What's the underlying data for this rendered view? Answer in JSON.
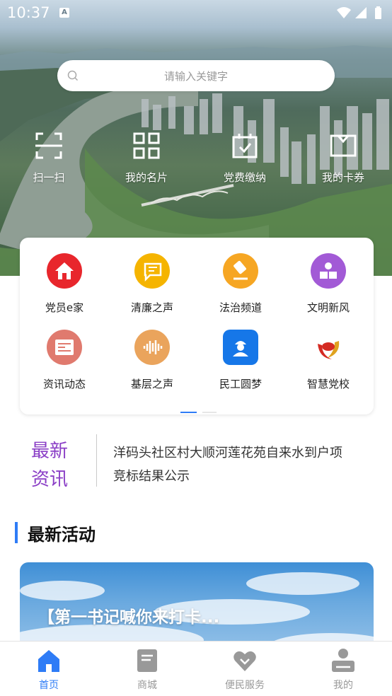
{
  "status_bar": {
    "time": "10:37",
    "a_badge": "A"
  },
  "search": {
    "placeholder": "请输入关键字"
  },
  "quick_actions": [
    {
      "label": "扫一扫",
      "icon": "scan-icon"
    },
    {
      "label": "我的名片",
      "icon": "qrcode-icon"
    },
    {
      "label": "党费缴纳",
      "icon": "payment-icon"
    },
    {
      "label": "我的卡券",
      "icon": "coupon-icon"
    }
  ],
  "services": [
    {
      "label": "党员e家",
      "icon": "home-icon",
      "color": "#e8262c"
    },
    {
      "label": "清廉之声",
      "icon": "chat-bubble-icon",
      "color": "#f5b400"
    },
    {
      "label": "法治频道",
      "icon": "gavel-icon",
      "color": "#f6a623"
    },
    {
      "label": "文明新风",
      "icon": "reader-icon",
      "color": "#a25ad6"
    },
    {
      "label": "资讯动态",
      "icon": "newspaper-icon",
      "color": "#e07a6e"
    },
    {
      "label": "基层之声",
      "icon": "soundwave-icon",
      "color": "#eaa45c"
    },
    {
      "label": "民工圆梦",
      "icon": "worker-icon",
      "color": "#1677e8"
    },
    {
      "label": "智慧党校",
      "icon": "party-school-logo-icon",
      "color": "#d42a22"
    }
  ],
  "news": {
    "tag_line1": "最新",
    "tag_line2": "资讯",
    "headline_line1": "洋码头社区村大顺河莲花苑自来水到户项",
    "headline_line2": "竞标结果公示"
  },
  "activity": {
    "section_title": "最新活动",
    "banner_title": "【第一书记喊你来打卡..."
  },
  "bottom_nav": [
    {
      "label": "首页",
      "icon": "home-tab-icon",
      "active": true
    },
    {
      "label": "商城",
      "icon": "shop-tab-icon",
      "active": false
    },
    {
      "label": "便民服务",
      "icon": "heart-tab-icon",
      "active": false
    },
    {
      "label": "我的",
      "icon": "profile-tab-icon",
      "active": false
    }
  ],
  "colors": {
    "accent": "#2e7cf6",
    "news_tag": "#8a3ec6"
  }
}
